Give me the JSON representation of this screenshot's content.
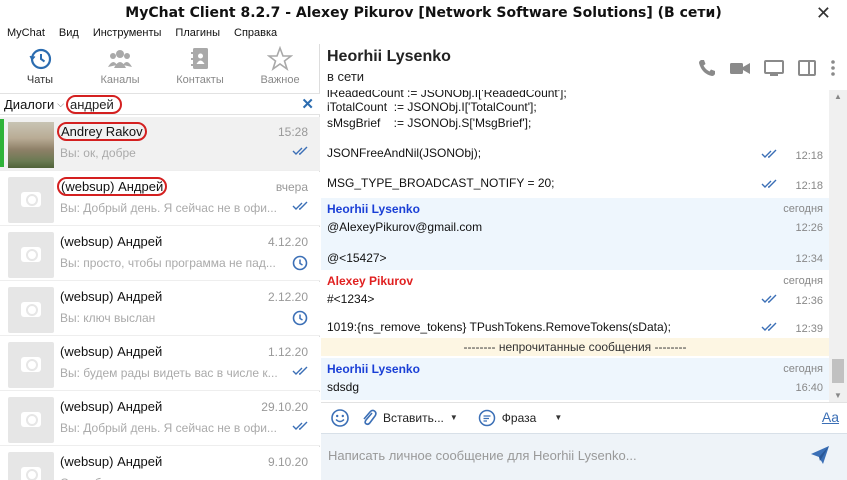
{
  "window": {
    "title": "MyChat Client 8.2.7 - Alexey Pikurov [Network Software Solutions] (В сети)"
  },
  "menu": [
    "MyChat",
    "Вид",
    "Инструменты",
    "Плагины",
    "Справка"
  ],
  "nav": {
    "tabs": [
      {
        "label": "Чаты",
        "icon": "history-icon",
        "active": true
      },
      {
        "label": "Каналы",
        "icon": "group-icon",
        "active": false
      },
      {
        "label": "Контакты",
        "icon": "contacts-book-icon",
        "active": false
      },
      {
        "label": "Важное",
        "icon": "star-icon",
        "active": false
      }
    ]
  },
  "search": {
    "label": "Диалоги",
    "value": "андрей"
  },
  "dialogs": [
    {
      "name": "Andrey Rakov",
      "time": "15:28",
      "preview": "Вы: ок, добре",
      "status": "double-check-icon",
      "avatar": "photo",
      "selected": true
    },
    {
      "name": "(websup) Андрей",
      "time": "вчера",
      "preview": "Вы: Добрый день. Я сейчас не в офи...",
      "status": "double-check-icon",
      "avatar": "camera-placeholder"
    },
    {
      "name": "(websup) Андрей",
      "time": "4.12.20",
      "preview": "Вы: просто, чтобы программа не пад...",
      "status": "clock-icon",
      "avatar": "camera-placeholder"
    },
    {
      "name": "(websup) Андрей",
      "time": "2.12.20",
      "preview": "Вы: ключ выслан",
      "status": "clock-icon",
      "avatar": "camera-placeholder"
    },
    {
      "name": "(websup) Андрей",
      "time": "1.12.20",
      "preview": "Вы: будем рады видеть вас в числе к...",
      "status": "double-check-icon",
      "avatar": "camera-placeholder"
    },
    {
      "name": "(websup) Андрей",
      "time": "29.10.20",
      "preview": "Вы: Добрый день. Я сейчас не в офи...",
      "status": "double-check-icon",
      "avatar": "camera-placeholder"
    },
    {
      "name": "(websup) Андрей",
      "time": "9.10.20",
      "preview": "Спасибо",
      "status": "",
      "avatar": "camera-placeholder"
    }
  ],
  "chat": {
    "name": "Heorhii Lysenko",
    "status": "в сети",
    "header_icons": [
      "phone-icon",
      "video-camera-icon",
      "screen-share-icon",
      "sidebar-toggle-icon",
      "more-vertical-icon"
    ],
    "code_lines": [
      "lReadedCount := JSONObj.I['ReadedCount'];",
      "iTotalCount  := JSONObj.I['TotalCount'];",
      "sMsgBrief    := JSONObj.S['MsgBrief'];"
    ],
    "messages": [
      {
        "text": "JSONFreeAndNil(JSONObj);",
        "time": "12:18",
        "ticks": true
      },
      {
        "text": "MSG_TYPE_BROADCAST_NOTIFY     = 20;",
        "time": "12:18",
        "ticks": true
      },
      {
        "sender": "Heorhii Lysenko",
        "sender_color": "#1a3fd6",
        "day": "сегодня",
        "text": "@AlexeyPikurov@gmail.com",
        "time": "12:26"
      },
      {
        "text": "@<15427>",
        "time": "12:34"
      },
      {
        "sender": "Alexey Pikurov",
        "sender_color": "#e02020",
        "day": "сегодня",
        "text": "#<1234>",
        "time": "12:36",
        "ticks": true
      },
      {
        "text": "1019:{ns_remove_tokens} TPushTokens.RemoveTokens(sData);",
        "time": "12:39",
        "ticks": true
      },
      {
        "sender": "Heorhii Lysenko",
        "sender_color": "#1a3fd6",
        "day": "сегодня",
        "text": "sdsdg",
        "time": "16:40"
      }
    ],
    "unread_divider": "-------- непрочитанные сообщения --------"
  },
  "toolbar": {
    "insert_label": "Вставить...",
    "phrase_label": "Фраза",
    "font_label": "Aa"
  },
  "input": {
    "placeholder": "Написать личное сообщение для Heorhii Lysenko..."
  },
  "colors": {
    "accent": "#2b6cb0",
    "online": "#2fb339",
    "highlight": "#d42020",
    "tick": "#3b6fb6"
  }
}
